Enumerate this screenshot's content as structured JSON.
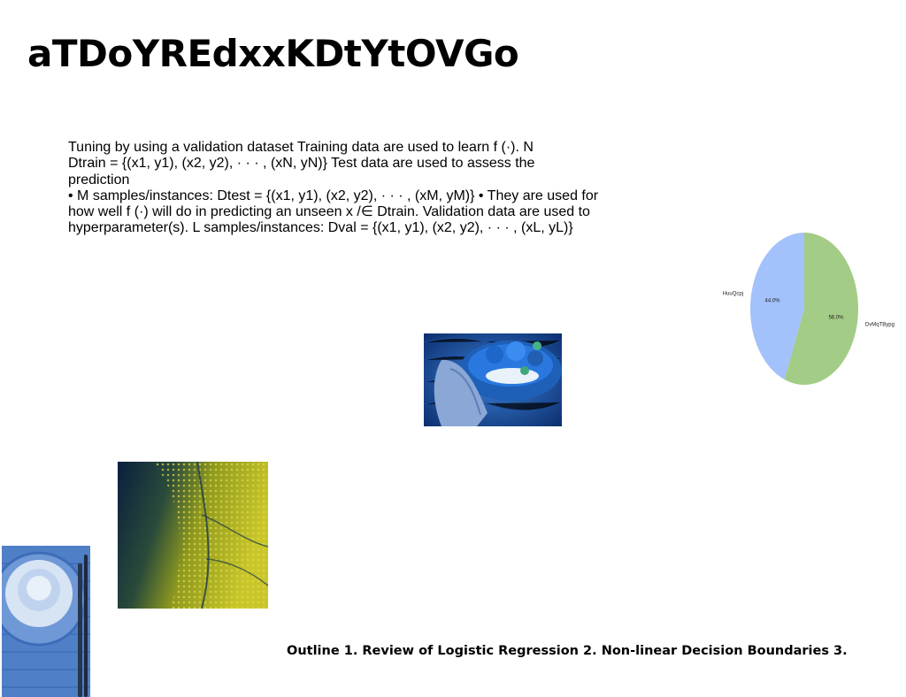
{
  "slide": {
    "title": "aTDoYREdxxKDtYtOVGo",
    "body_lines": [
      "Tuning by using a validation dataset Training data are used to learn f (·). N",
      "Dtrain = {(x1, y1), (x2, y2), · · · , (xN, yN)} Test data are used to assess the prediction",
      "• M samples/instances: Dtest = {(x1, y1), (x2, y2), · · · , (xM, yM)} • They are used for",
      "how well f (·) will do in predicting an unseen x /∈ Dtrain. Validation data are used to",
      "hyperparameter(s). L samples/instances: Dval = {(x1, y1), (x2, y2), · · · , (xL, yL)}"
    ],
    "outline_text": "Outline 1. Review of Logistic Regression 2. Non-linear Decision Boundaries 3."
  },
  "images": {
    "bowl": "blue-toned photo of hand holding bowl with food",
    "leaf": "yellow-green textured leaf photo",
    "plate": "blue plate on woven placemat"
  },
  "chart_data": {
    "type": "pie",
    "slices": [
      {
        "label": "DvMqTBypg",
        "value": 56.0,
        "pct_label": "56.0%",
        "color": "#a3cc87"
      },
      {
        "label": "HuuQcpj",
        "value": 44.0,
        "pct_label": "44.0%",
        "color": "#a3c1fa"
      }
    ],
    "start_angle_deg": 90,
    "direction": "clockwise"
  }
}
